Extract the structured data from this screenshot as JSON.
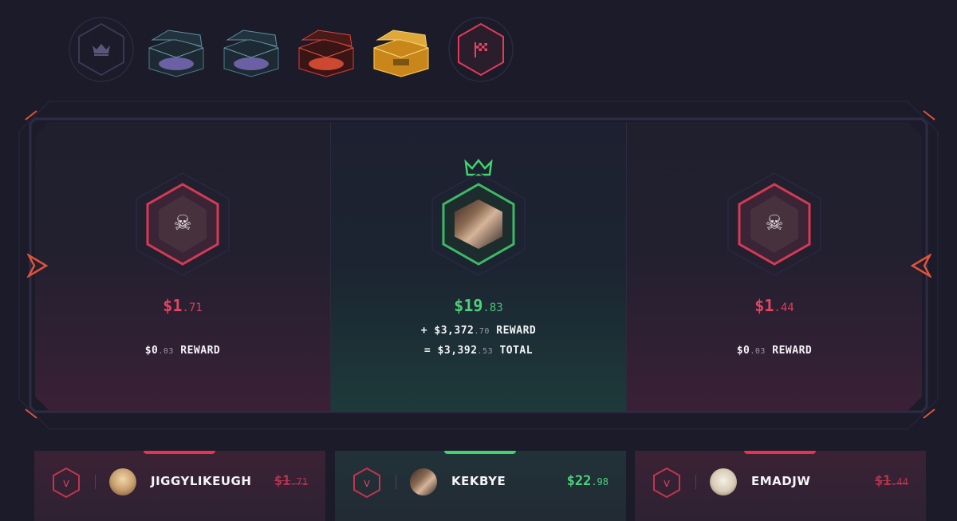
{
  "header": {
    "icons": [
      {
        "name": "crown-icon",
        "kind": "hex-crown"
      },
      {
        "name": "case-dark-blue-1",
        "kind": "case",
        "color": "#2e6b7a"
      },
      {
        "name": "case-dark-blue-2",
        "kind": "case",
        "color": "#2e6b7a"
      },
      {
        "name": "case-red",
        "kind": "case",
        "color": "#c2352f"
      },
      {
        "name": "case-gold",
        "kind": "case",
        "color": "#e9a423"
      },
      {
        "name": "flag-icon",
        "kind": "hex-flag"
      }
    ]
  },
  "slots": [
    {
      "result": "loss",
      "amount": "$1",
      "amount_cents": ".71",
      "reward": "$0",
      "reward_cents": ".03",
      "reward_label": "REWARD"
    },
    {
      "result": "win",
      "amount": "$19",
      "amount_cents": ".83",
      "reward_prefix": "+ ",
      "reward": "$3,372",
      "reward_cents": ".70",
      "reward_label": "REWARD",
      "total_prefix": "= ",
      "total": "$3,392",
      "total_cents": ".53",
      "total_label": "TOTAL"
    },
    {
      "result": "loss",
      "amount": "$1",
      "amount_cents": ".44",
      "reward": "$0",
      "reward_cents": ".03",
      "reward_label": "REWARD"
    }
  ],
  "players": [
    {
      "name": "JIGGYLIKEUGH",
      "amount": "$1",
      "amount_cents": ".71",
      "result": "loss",
      "badge": "V"
    },
    {
      "name": "KEKBYE",
      "amount": "$22",
      "amount_cents": ".98",
      "result": "win",
      "badge": "V"
    },
    {
      "name": "EMADJW",
      "amount": "$1",
      "amount_cents": ".44",
      "result": "loss",
      "badge": "V"
    }
  ],
  "colors": {
    "background": "#1c1b29",
    "loss": "#e94460",
    "win": "#4ed27a",
    "frame": "#2e2c45"
  }
}
